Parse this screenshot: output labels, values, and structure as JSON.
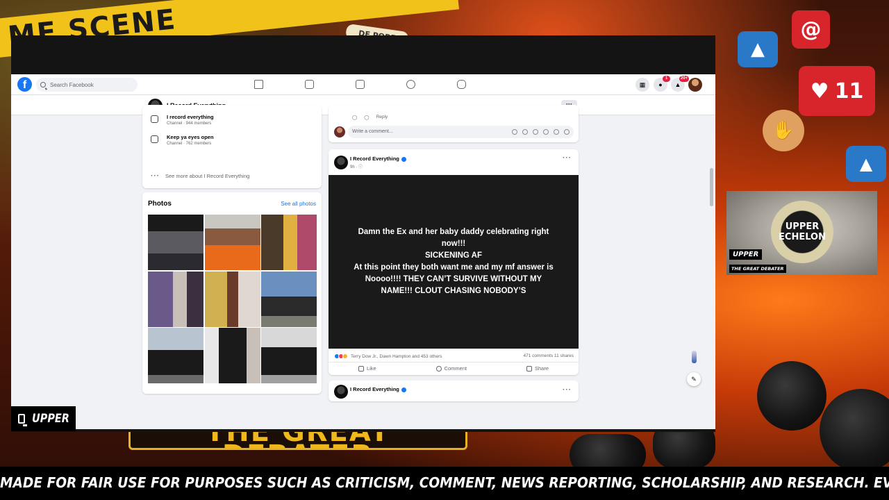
{
  "backdrop": {
    "tape_text": "ME SCENE",
    "sticker_text": "DE POBE",
    "reaction_count": "11",
    "plate_text": "THE GREAT DEBATER"
  },
  "facebook": {
    "search_placeholder": "Search Facebook",
    "notification_badges": [
      "1",
      "20+"
    ],
    "page_title": "I Record Everything",
    "more_button": "···",
    "channels": [
      {
        "name": "I record everything",
        "meta": "Channel · 944 members"
      },
      {
        "name": "Keep ya eyes open",
        "meta": "Channel · 762 members"
      }
    ],
    "see_more": "See more about I Record Everything",
    "photos": {
      "title": "Photos",
      "see_all": "See all photos"
    },
    "prev_post": {
      "reply": "Reply",
      "comment_placeholder": "Write a comment..."
    },
    "post": {
      "author": "I Record Everything",
      "meta": "9h · ⓘ",
      "text_lines": [
        "Damn the Ex and her baby daddy celebrating right",
        "now!!!",
        "SICKENING AF",
        "At this point they both want me and my mf answer is",
        "Noooo!!!! THEY CAN’T SURVIVE WITHOUT MY",
        "NAME!!! CLOUT CHASING NOBODY’S"
      ],
      "reactions_text": "Terry Dow Jr., Dawn Hampton and 453 others",
      "counts_text": "471 comments   11 shares",
      "like": "Like",
      "comment": "Comment",
      "share": "Share"
    },
    "next_post": {
      "author": "I Record Everything"
    },
    "colors": {
      "brand": "#1877f2",
      "page_bg": "#f0f2f5"
    }
  },
  "overlay": {
    "frame_label": "UPPER",
    "cam_logo_line1": "UPPER",
    "cam_logo_line2": "ECHELON",
    "cam_tag1": "UPPER",
    "cam_tag2": "THE GREAT DEBATER",
    "ticker": "MADE FOR FAIR USE FOR PURPOSES SUCH AS CRITICISM, COMMENT, NEWS REPORTING, SCHOLARSHIP, AND RESEARCH. EVERYTHING IN THIS LIVE STREAM"
  }
}
